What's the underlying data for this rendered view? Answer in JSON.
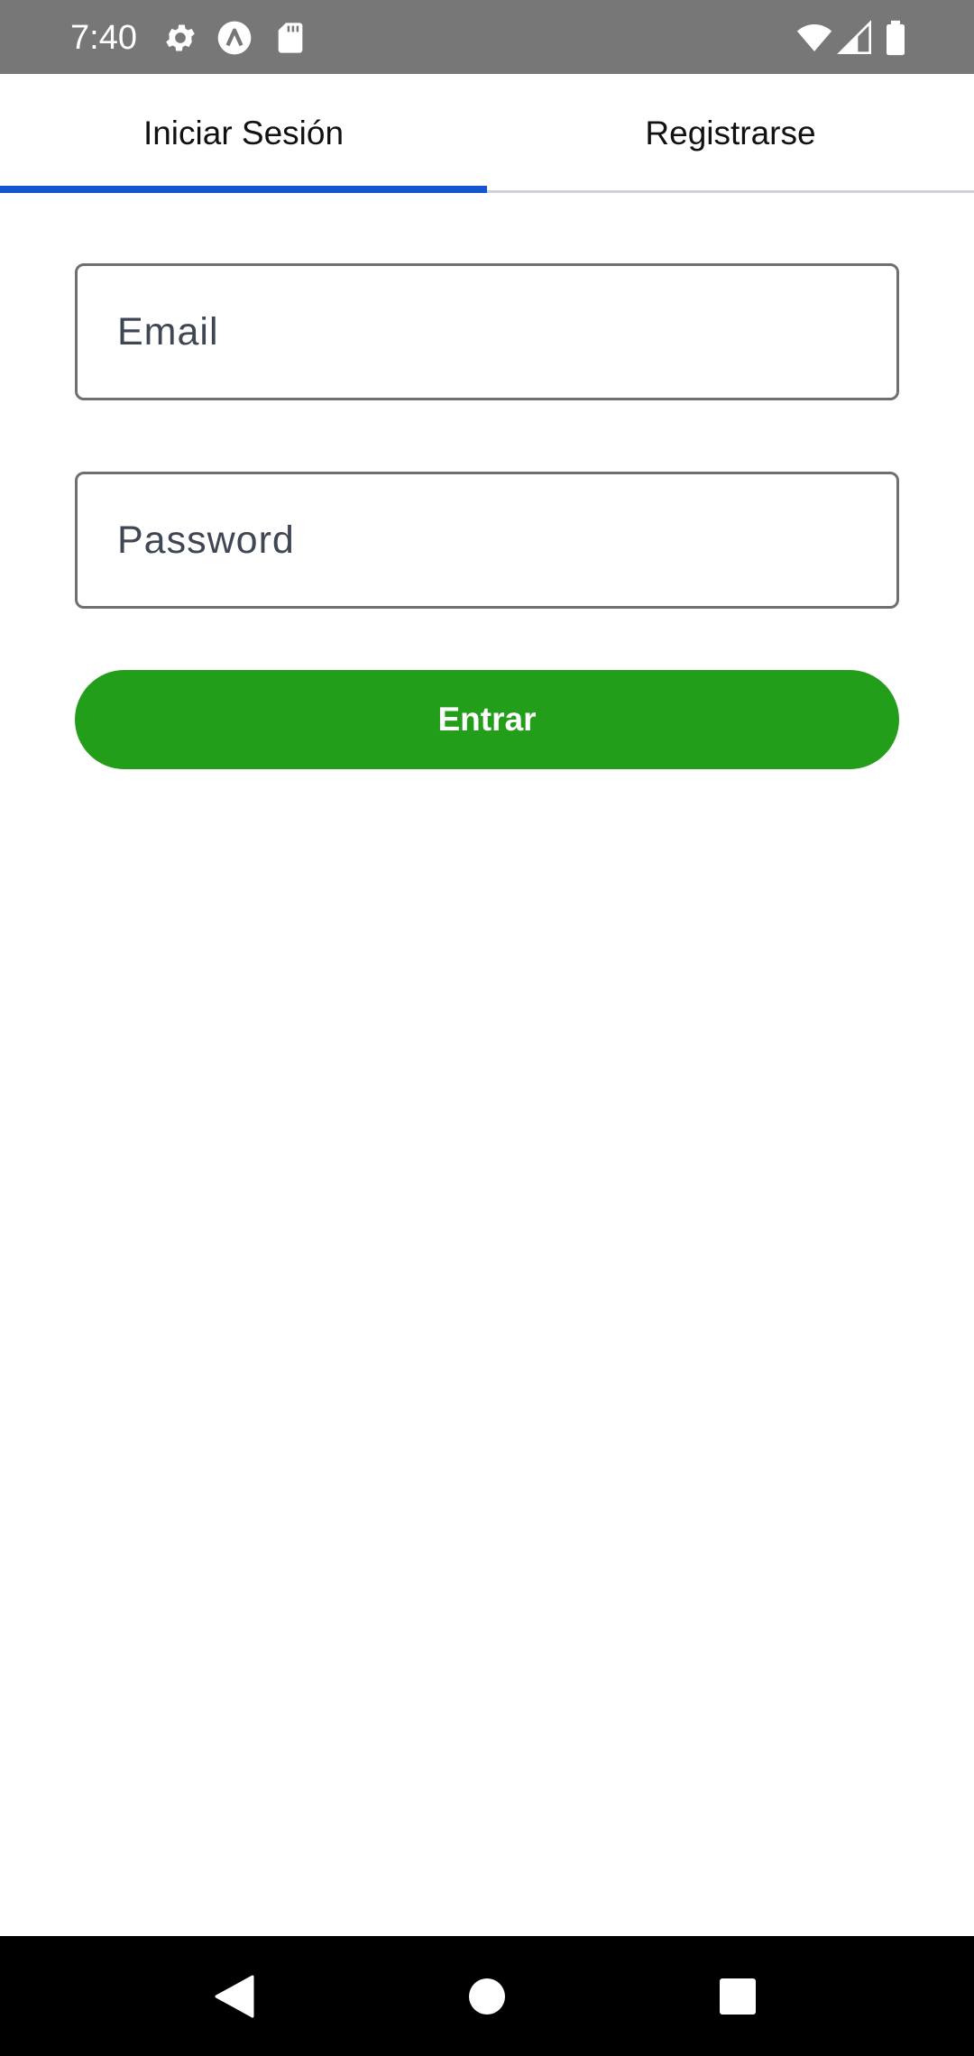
{
  "status_bar": {
    "time": "7:40",
    "icons_left": [
      "gear-icon",
      "a-circle-icon",
      "sd-card-icon"
    ],
    "icons_right": [
      "wifi-icon",
      "cell-signal-icon",
      "battery-icon"
    ],
    "background": "#777777"
  },
  "tabs": [
    {
      "label": "Iniciar Sesión",
      "selected": true
    },
    {
      "label": "Registrarse",
      "selected": false
    }
  ],
  "tab_indicator_color": "#1454d0",
  "form": {
    "email": {
      "placeholder": "Email",
      "value": ""
    },
    "password": {
      "placeholder": "Password",
      "value": ""
    },
    "submit_label": "Entrar",
    "submit_color": "#229e1a"
  },
  "nav_bar": {
    "buttons": [
      "back-icon",
      "home-icon",
      "recents-icon"
    ]
  }
}
